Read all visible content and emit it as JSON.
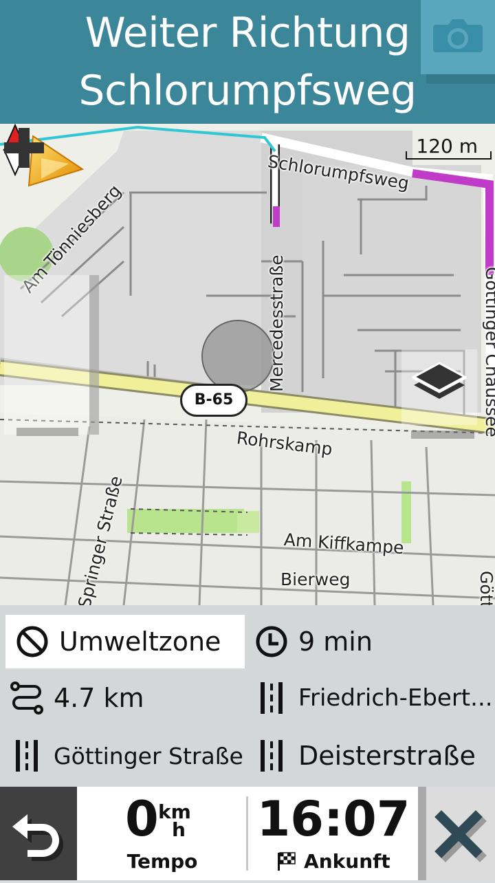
{
  "header": {
    "instruction_line1": "Weiter Richtung",
    "instruction_line2": "Schlorumpfsweg",
    "camera_icon": "camera-icon"
  },
  "map": {
    "scale": "120 m",
    "road_shield": "B-65",
    "streets": {
      "am_toenniesberg": "Am Tönniesberg",
      "schlorumpfsweg": "Schlorumpfsweg",
      "mercedesstrasse": "Mercedesstraße",
      "goettinger_chaussee": "Göttinger Chaussee",
      "goett_edge": "Gött",
      "rohrskamp": "Rohrskamp",
      "springer_strasse": "Springer Straße",
      "am_kiffkampe": "Am Kiffkampe",
      "bierweg": "Bierweg"
    },
    "colors": {
      "route": "#c03cc8",
      "highway": "#f0f09a",
      "header": "#3b8698"
    }
  },
  "info": {
    "environment_zone": "Umweltzone",
    "time_remaining": "9 min",
    "distance": "4.7 km",
    "street_1": "Friedrich-Ebert...",
    "street_2": "Göttinger Straße",
    "street_3": "Deisterstraße"
  },
  "bottom": {
    "speed_value": "0",
    "speed_unit_top": "km",
    "speed_unit_bottom": "h",
    "speed_label": "Tempo",
    "arrival_time": "16:07",
    "arrival_label": "Ankunft"
  }
}
